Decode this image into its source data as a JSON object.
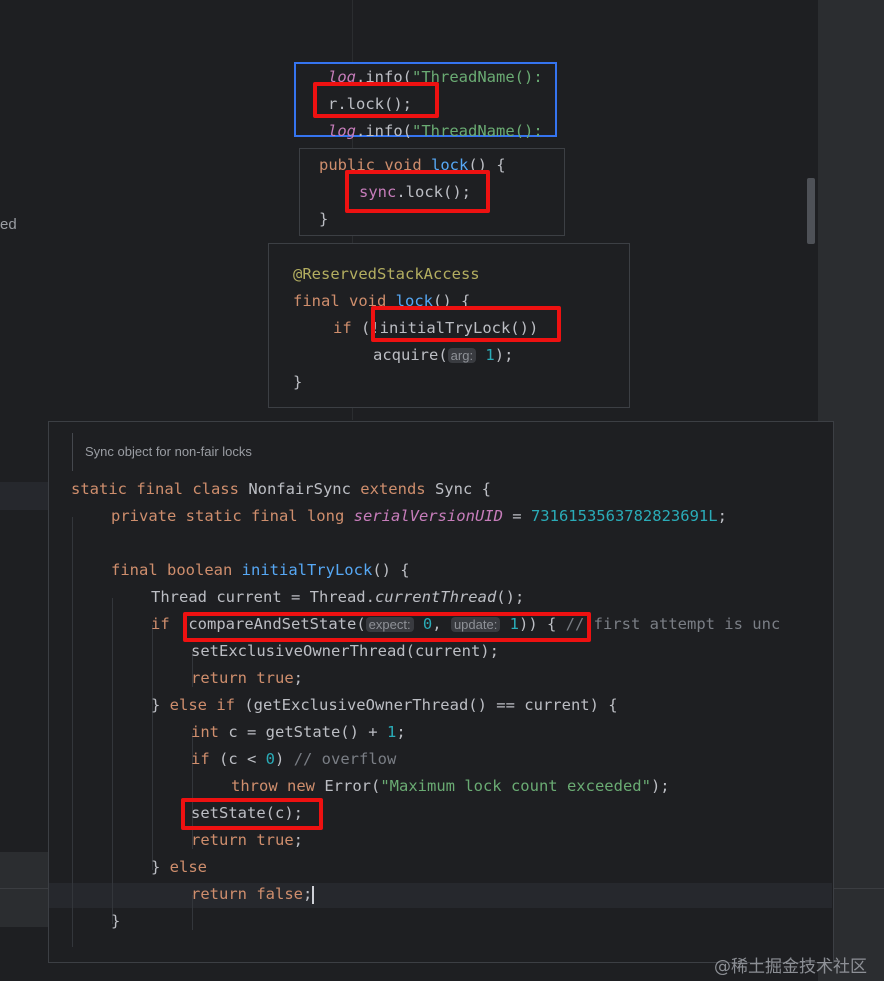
{
  "background": {
    "side_text": "ed"
  },
  "panel1": {
    "lines": [
      {
        "obj": "log",
        "mid": ".info(",
        "str": "\"ThreadName():"
      },
      {
        "text": "r.lock();"
      },
      {
        "obj": "log",
        "mid": ".info(",
        "str": "\"ThreadName():"
      }
    ]
  },
  "panel2": {
    "line1_kw": "public void ",
    "line1_fn": "lock",
    "line1_rest": "() {",
    "line2_fld": "sync",
    "line2_rest": ".lock();",
    "line3": "}"
  },
  "panel3": {
    "annotation": "@ReservedStackAccess",
    "l2_kw": "final void ",
    "l2_fn": "lock",
    "l2_rest": "() {",
    "l3_kw": "if ",
    "l3_rest": "(!initialTryLock())",
    "l4_pre": "acquire(",
    "l4_hint": "arg:",
    "l4_num": "1",
    "l4_post": ");",
    "l5": "}"
  },
  "panel4": {
    "doc_comment": "Sync object for non-fair locks",
    "class_kw": "static final class ",
    "class_name": "NonfairSync ",
    "extends_kw": "extends ",
    "super_name": "Sync {",
    "field_kw": "private static final long ",
    "field_name": "serialVersionUID",
    "field_eq": " = ",
    "field_val": "7316153563782823691L",
    "field_end": ";",
    "method_kw": "final boolean ",
    "method_name": "initialTryLock",
    "method_rest": "() {",
    "thread_type": "Thread current = Thread.",
    "thread_call": "currentThread",
    "thread_end": "();",
    "if_kw": "if ",
    "cas_call": "compareAndSetState(",
    "hint_expect": "expect:",
    "num_0": "0",
    "comma": ", ",
    "hint_update": "update:",
    "num_1": "1",
    "cas_end": ")) { ",
    "cas_comment": "// first attempt is unc",
    "set_owner": "setExclusiveOwnerThread(current);",
    "return_kw": "return ",
    "true_kw": "true",
    "semi": ";",
    "else_close": "} ",
    "else_kw": "else if ",
    "else_rest": "(getExclusiveOwnerThread() == current) {",
    "int_kw": "int ",
    "int_rest": "c = getState() + ",
    "int_num": "1",
    "if2_kw": "if ",
    "if2_rest": "(c < ",
    "if2_num": "0",
    "if2_close": ") ",
    "if2_comment": "// overflow",
    "throw_kw": "throw new ",
    "throw_rest": "Error(",
    "throw_str": "\"Maximum lock count exceeded\"",
    "throw_end": ");",
    "setstate": "setState(c);",
    "else2_close": "} ",
    "else2_kw": "else",
    "false_kw": "false",
    "close_brace": "}"
  },
  "watermark": "@稀土掘金技术社区",
  "colors": {
    "highlight_box": "#ee1111",
    "keyword": "#cf8e6d",
    "string": "#6aab73",
    "number": "#2aacb8",
    "function": "#56a8f5",
    "field": "#c77dbb"
  }
}
